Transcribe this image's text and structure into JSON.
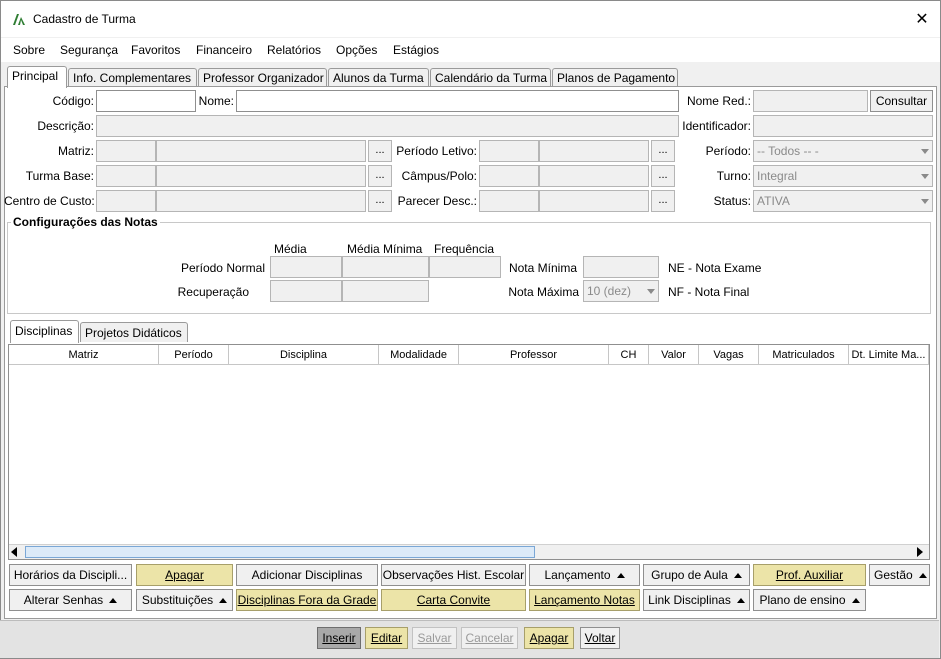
{
  "window": {
    "title": "Cadastro de Turma",
    "close_glyph": "✕"
  },
  "menu": [
    "Sobre",
    "Segurança",
    "Favoritos",
    "Financeiro",
    "Relatórios",
    "Opções",
    "Estágios"
  ],
  "tabs": [
    "Principal",
    "Info. Complementares",
    "Professor Organizador",
    "Alunos da Turma",
    "Calendário da Turma",
    "Planos de Pagamento"
  ],
  "form": {
    "codigo_label": "Código:",
    "nome_label": "Nome:",
    "nome_red_label": "Nome Red.:",
    "consultar_label": "Consultar",
    "descricao_label": "Descrição:",
    "identificador_label": "Identificador:",
    "matriz_label": "Matriz:",
    "periodo_letivo_label": "Período Letivo:",
    "periodo_label": "Período:",
    "periodo_value": "-- Todos -- -",
    "turma_base_label": "Turma Base:",
    "campus_label": "Câmpus/Polo:",
    "turno_label": "Turno:",
    "turno_value": "Integral",
    "centro_custo_label": "Centro de Custo:",
    "parecer_label": "Parecer Desc.:",
    "status_label": "Status:",
    "status_value": "ATIVA",
    "dots": "..."
  },
  "notas": {
    "title": "Configurações das Notas",
    "col_media": "Média",
    "col_media_minima": "Média Mínima",
    "col_frequencia": "Frequência",
    "row_normal": "Período Normal",
    "row_recuperacao": "Recuperação",
    "nota_minima_label": "Nota Mínima",
    "nota_maxima_label": "Nota Máxima",
    "nota_maxima_value": "10 (dez)",
    "ne_text": "NE - Nota Exame",
    "nf_text": "NF - Nota Final"
  },
  "subtabs": [
    "Disciplinas",
    "Projetos Didáticos"
  ],
  "grid_columns": [
    "Matriz",
    "Período",
    "Disciplina",
    "Modalidade",
    "Professor",
    "CH",
    "Valor",
    "Vagas",
    "Matriculados",
    "Dt. Limite Ma..."
  ],
  "action_row1": [
    "Horários da Discipli...",
    "Apagar",
    "Adicionar Disciplinas",
    "Observações Hist. Escolar",
    "Lançamento",
    "Grupo de Aula",
    "Prof. Auxiliar",
    "Gestão"
  ],
  "action_row2": [
    "Alterar Senhas",
    "Substituições",
    "Disciplinas Fora da Grade",
    "Carta Convite",
    "Lançamento Notas",
    "Link Disciplinas",
    "Plano de ensino"
  ],
  "bottom": [
    "Inserir",
    "Editar",
    "Salvar",
    "Cancelar",
    "Apagar",
    "Voltar"
  ],
  "colors": {
    "accent_yellow": "#ece4a8",
    "icon_green": "#2e7d32"
  }
}
